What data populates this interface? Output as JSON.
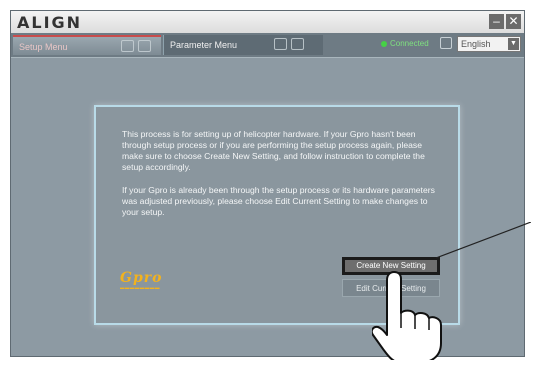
{
  "window": {
    "logo": "ALIGN",
    "minimize_label": "–",
    "close_label": "✕"
  },
  "tabs": [
    {
      "label": "Setup Menu",
      "active": true
    },
    {
      "label": "Parameter Menu",
      "active": false
    }
  ],
  "status": {
    "connected_label": "Connected",
    "language": "English"
  },
  "dialog": {
    "paragraph1": "This process is for setting up of helicopter hardware. If your Gpro hasn't been through setup process or if you are performing the setup process again, please make sure to choose Create New Setting, and follow instruction to complete the setup accordingly.",
    "paragraph2": "If your Gpro is already been through the setup process or its hardware parameters was adjusted previously, please choose Edit Current Setting to make changes to your setup.",
    "brand_name": "Gpro",
    "create_button": "Create New Setting",
    "edit_button": "Edit Current Setting"
  },
  "colors": {
    "background": "#8d9aa3",
    "panel_border": "#b9dbe8",
    "brand": "#f3b21d",
    "connected": "#46d246"
  },
  "icons": [
    "save-icon",
    "open-folder-icon",
    "globe-icon",
    "hand-pointer-icon"
  ]
}
